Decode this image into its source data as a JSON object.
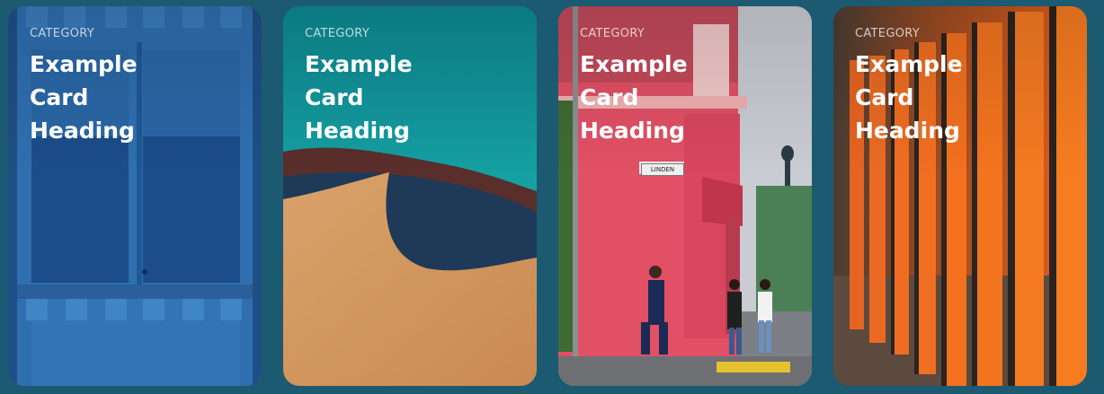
{
  "cards": [
    {
      "category": "CATEGORY",
      "heading_lines": [
        "Example",
        "Card",
        "Heading"
      ],
      "image": "blue-painted-door"
    },
    {
      "category": "CATEGORY",
      "heading_lines": [
        "Example",
        "Card",
        "Heading"
      ],
      "image": "sand-dune-teal-sky"
    },
    {
      "category": "CATEGORY",
      "heading_lines": [
        "Example",
        "Card",
        "Heading"
      ],
      "image": "pink-building-street",
      "street_sign": "LINDEN"
    },
    {
      "category": "CATEGORY",
      "heading_lines": [
        "Example",
        "Card",
        "Heading"
      ],
      "image": "orange-torii-posts"
    }
  ],
  "colors": {
    "page_background": "#1c5a72",
    "text": "#ffffff"
  }
}
